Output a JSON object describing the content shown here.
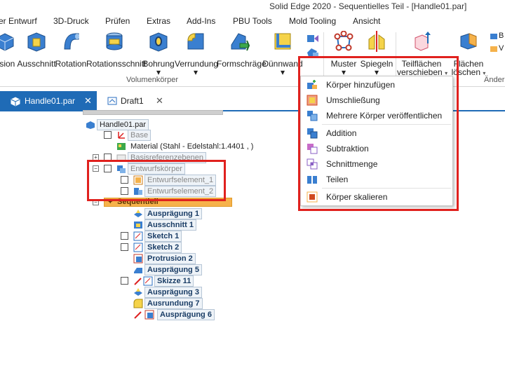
{
  "title": "Solid Edge 2020 - Sequentielles Teil - [Handle01.par]",
  "tabs": [
    "er Entwurf",
    "3D-Druck",
    "Prüfen",
    "Extras",
    "Add-Ins",
    "PBU Tools",
    "Mold Tooling",
    "Ansicht"
  ],
  "ribbon": {
    "tools": {
      "trusion": "usion",
      "ausschnitt": "Ausschnitt",
      "rotation": "Rotation",
      "rotationsschnitt": "Rotationsschnitt",
      "bohrung": "Bohrung",
      "verrundung": "Verrundung",
      "formschraege": "Formschräge",
      "duennwand": "Dünnwand",
      "muster": "Muster",
      "spiegeln": "Spiegeln",
      "teilflaechen_1": "Teilflächen",
      "teilflaechen_2": "verschieben",
      "flaechen_1": "Flächen",
      "flaechen_2": "löschen"
    },
    "group_volumenkoerper": "Volumenkörper",
    "group_aender": "Änder",
    "edge_letters": [
      "B",
      "V"
    ]
  },
  "doc_tabs": {
    "active": "Handle01.par",
    "second": "Draft1",
    "close": "✕"
  },
  "tree": {
    "root": "Handle01.par",
    "base": "Base",
    "material": "Material (Stahl - Edelstahl:1.4401 , )",
    "basisref": "Basisreferenzebenen",
    "entwurfskoerper": "Entwurfskörper",
    "entwurfselement_1": "Entwurfselement_1",
    "entwurfselement_2": "Entwurfselement_2",
    "sequentiell": "Sequentiell",
    "items": [
      "Ausprägung 1",
      "Ausschnitt 1",
      "Sketch 1",
      "Sketch 2",
      "Protrusion 2",
      "Ausprägung 5",
      "Skizze 11",
      "Ausprägung 3",
      "Ausrundung 7",
      "Ausprägung 6"
    ]
  },
  "menu": {
    "koerper_hinzufuegen": "Körper hinzufügen",
    "umschliessung": "Umschließung",
    "mehrere_koerper": "Mehrere Körper veröffentlichen",
    "addition": "Addition",
    "subtraktion": "Subtraktion",
    "schnittmenge": "Schnittmenge",
    "teilen": "Teilen",
    "koerper_skalieren": "Körper skalieren"
  },
  "colors": {
    "accent_blue": "#1f6bb6",
    "highlight_red": "#e0211e",
    "sequentiell_orange": "#f6b24b"
  }
}
